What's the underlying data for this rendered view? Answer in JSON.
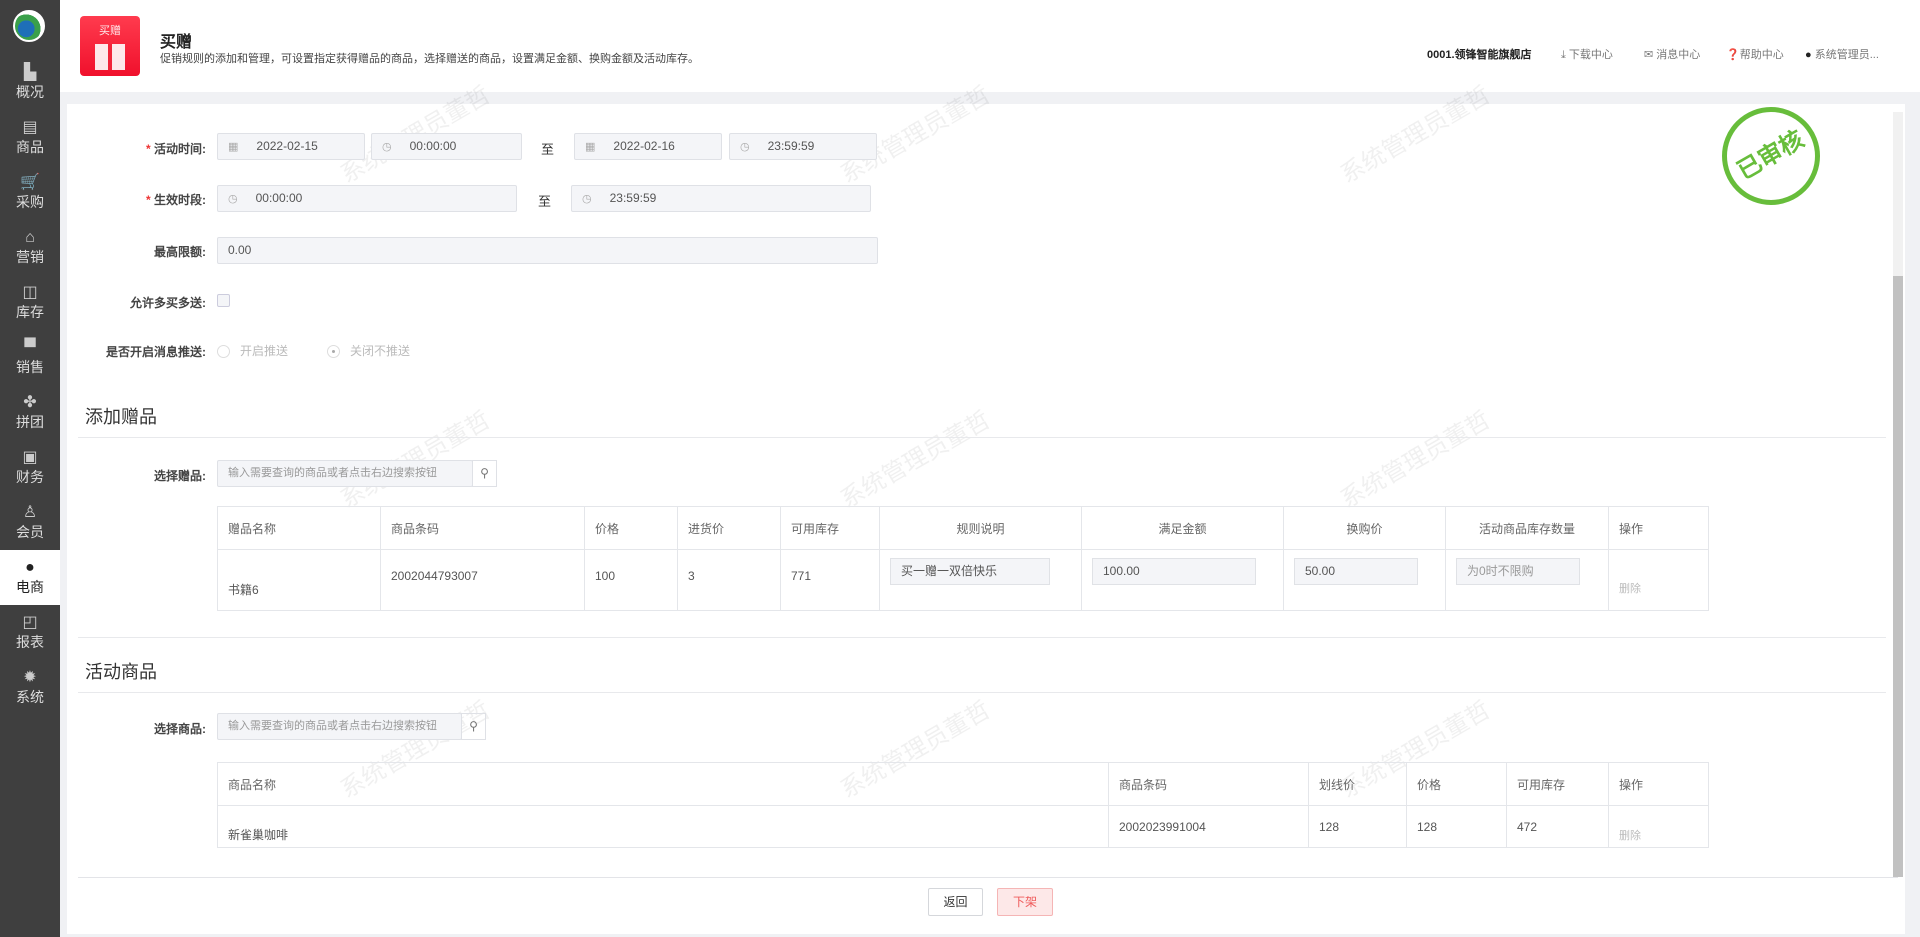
{
  "sidebar": {
    "items": [
      {
        "label": "概况",
        "icon": "building-icon"
      },
      {
        "label": "商品",
        "icon": "document-icon"
      },
      {
        "label": "采购",
        "icon": "cart-icon"
      },
      {
        "label": "营销",
        "icon": "marketing-icon"
      },
      {
        "label": "库存",
        "icon": "box-icon"
      },
      {
        "label": "销售",
        "icon": "register-icon"
      },
      {
        "label": "拼团",
        "icon": "group-icon"
      },
      {
        "label": "财务",
        "icon": "finance-icon"
      },
      {
        "label": "会员",
        "icon": "member-icon"
      },
      {
        "label": "电商",
        "icon": "ecommerce-icon",
        "active": true
      },
      {
        "label": "报表",
        "icon": "report-icon"
      },
      {
        "label": "系统",
        "icon": "gear-icon"
      }
    ]
  },
  "header": {
    "icon_label": "买赠",
    "title": "买赠",
    "description": "促销规则的添加和管理，可设置指定获得赠品的商品，选择赠送的商品，设置满足金额、换购金额及活动库存。",
    "store": "0001.领锋智能旗舰店",
    "download": "下载中心",
    "messages": "消息中心",
    "help": "帮助中心",
    "user": "系统管理员..."
  },
  "stamp": "已审核",
  "watermark": "系统管理员董哲",
  "form": {
    "activity_time": {
      "label": "活动时间:",
      "start_date": "2022-02-15",
      "start_time": "00:00:00",
      "to": "至",
      "end_date": "2022-02-16",
      "end_time": "23:59:59"
    },
    "effective_period": {
      "label": "生效时段:",
      "start": "00:00:00",
      "to": "至",
      "end": "23:59:59"
    },
    "max_limit": {
      "label": "最高限额:",
      "value": "0.00"
    },
    "allow_multi": {
      "label": "允许多买多送:",
      "checked": false
    },
    "push": {
      "label": "是否开启消息推送:",
      "on": "开启推送",
      "off": "关闭不推送",
      "selected": "off"
    }
  },
  "gifts": {
    "title": "添加赠品",
    "select_label": "选择赠品:",
    "placeholder": "输入需要查询的商品或者点击右边搜索按钮",
    "columns": [
      "赠品名称",
      "商品条码",
      "价格",
      "进货价",
      "可用库存",
      "规则说明",
      "满足金额",
      "换购价",
      "活动商品库存数量",
      "操作"
    ],
    "rows": [
      {
        "name": "书籍6",
        "barcode": "2002044793007",
        "price": "100",
        "cost": "3",
        "stock": "771",
        "rule": "买一赠一双倍快乐",
        "threshold": "100.00",
        "swap_price": "50.00",
        "qty_placeholder": "为0时不限购",
        "action": "删除"
      }
    ]
  },
  "products": {
    "title": "活动商品",
    "select_label": "选择商品:",
    "placeholder": "输入需要查询的商品或者点击右边搜索按钮",
    "columns": [
      "商品名称",
      "商品条码",
      "划线价",
      "价格",
      "可用库存",
      "操作"
    ],
    "rows": [
      {
        "name": "新雀巢咖啡",
        "barcode": "2002023991004",
        "list_price": "128",
        "price": "128",
        "stock": "472",
        "action": "删除"
      }
    ]
  },
  "footer": {
    "back": "返回",
    "delist": "下架"
  }
}
